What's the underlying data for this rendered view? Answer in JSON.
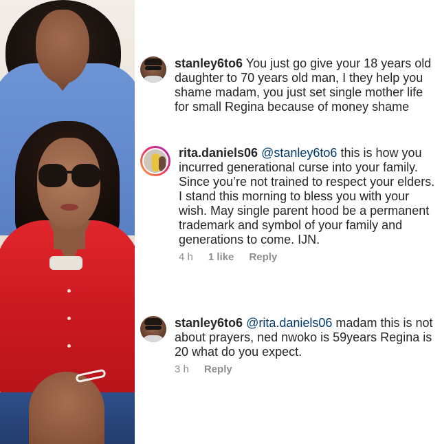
{
  "comments": [
    {
      "username": "stanley6to6",
      "mention": "",
      "text": "You just go give your 18 years old daughter to 70 years old man, I they help you shame madam, you just set single mother life for small Regina because of money shame"
    },
    {
      "username": "rita.daniels06",
      "mention": "@stanley6to6",
      "text": "this is how you incurred generational curse into your family. Since you’re not trained to respect your elders. I stand this morning to bless you with your wish. May single parent hood be a permanent trademark and symbol of your family and generations to come. IJN.",
      "time": "4 h",
      "likes": "1 like",
      "reply": "Reply"
    },
    {
      "username": "stanley6to6",
      "mention": "@rita.daniels06",
      "text": "madam this is not about prayers, ned nwoko is 59years Regina is 20 what do you expect.",
      "time": "3 h",
      "reply": "Reply"
    }
  ],
  "colors": {
    "text": "#262626",
    "mention": "#00376b",
    "meta": "#8e8e8e"
  },
  "icons": {
    "photo": "mother-and-daughter-photo",
    "avatar_stanley": "profile-avatar",
    "avatar_rita": "profile-avatar-story-ring"
  }
}
